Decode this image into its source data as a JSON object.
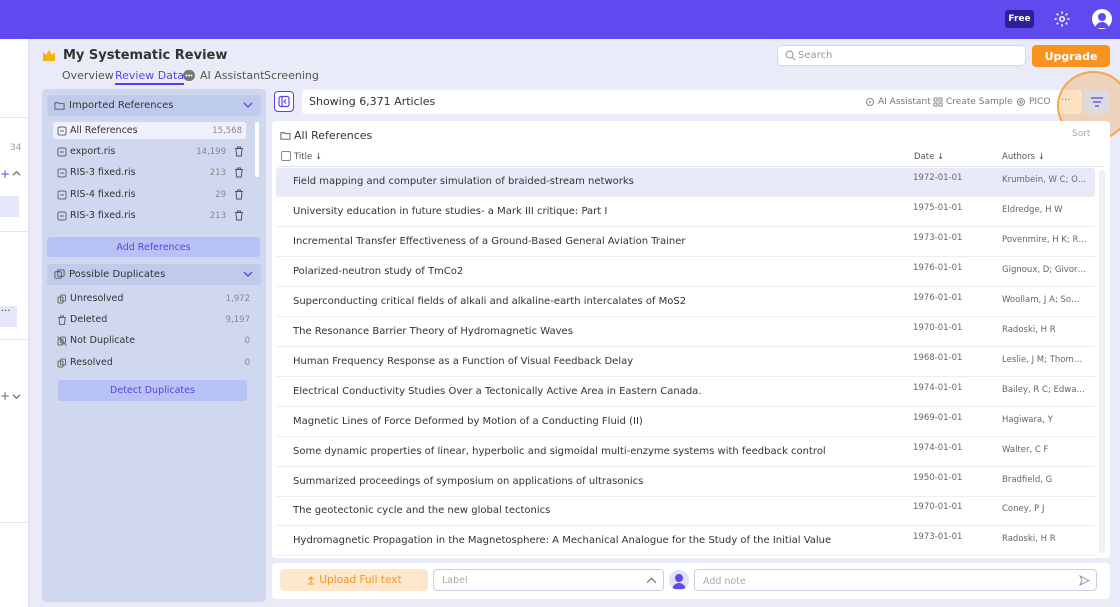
{
  "topbar": {
    "plan_badge": "Free",
    "brand_color": "#6149f0"
  },
  "left_strip": {
    "count": "34",
    "plus": "+",
    "more": "···"
  },
  "header": {
    "project_title": "My Systematic Review",
    "tabs": [
      {
        "label": "Overview"
      },
      {
        "label": "Review Data",
        "active": true
      },
      {
        "label": "AI Assistant"
      },
      {
        "label": "Screening"
      }
    ],
    "search_placeholder": "Search",
    "upgrade_label": "Upgrade",
    "upgrade_color": "#f7931e"
  },
  "sidebar": {
    "imported_title": "Imported References",
    "references": [
      {
        "name": "All References",
        "count": "15,568"
      },
      {
        "name": "export.ris",
        "count": "14,199"
      },
      {
        "name": "RIS-3 fixed.ris",
        "count": "213"
      },
      {
        "name": "RIS-4 fixed.ris",
        "count": "29"
      },
      {
        "name": "RIS-3 fixed.ris",
        "count": "213"
      }
    ],
    "add_references_label": "Add References",
    "duplicates_title": "Possible Duplicates",
    "duplicates": [
      {
        "name": "Unresolved",
        "count": "1,972"
      },
      {
        "name": "Deleted",
        "count": "9,197"
      },
      {
        "name": "Not Duplicate",
        "count": "0"
      },
      {
        "name": "Resolved",
        "count": "0"
      }
    ],
    "detect_label": "Detect Duplicates"
  },
  "toolbar": {
    "showing": "Showing 6,371 Articles",
    "ai_assistant": "AI Assistant",
    "create_sample": "Create Sample",
    "pico": "PICO",
    "more": "···"
  },
  "table": {
    "caption": "All References",
    "sort_label": "Sort",
    "col_title": "Title ↓",
    "col_date": "Date ↓",
    "col_authors": "Authors ↓",
    "rows": [
      {
        "title": "Field mapping and computer simulation of braided-stream networks",
        "date": "1972-01-01",
        "authors": "Krumbein, W C; O…"
      },
      {
        "title": "University education in future studies- a Mark III critique: Part I",
        "date": "1975-01-01",
        "authors": "Eldredge, H W"
      },
      {
        "title": "Incremental Transfer Effectiveness of a Ground-Based General Aviation Trainer",
        "date": "1973-01-01",
        "authors": "Povenmire, H K; R…"
      },
      {
        "title": "Polarized-neutron study of TmCo2",
        "date": "1976-01-01",
        "authors": "Gignoux, D; Givor…"
      },
      {
        "title": "Superconducting critical fields of alkali and alkaline-earth intercalates of MoS2",
        "date": "1976-01-01",
        "authors": "Woollam, J A; So…"
      },
      {
        "title": "The Resonance Barrier Theory of Hydromagnetic Waves",
        "date": "1970-01-01",
        "authors": "Radoski, H R"
      },
      {
        "title": "Human Frequency Response as a Function of Visual Feedback Delay",
        "date": "1968-01-01",
        "authors": "Leslie, J M; Thom…"
      },
      {
        "title": "Electrical Conductivity Studies Over a Tectonically Active Area in Eastern Canada.",
        "date": "1974-01-01",
        "authors": "Bailey, R C; Edwa…"
      },
      {
        "title": "Magnetic Lines of Force Deformed by Motion of a Conducting Fluid (II)",
        "date": "1969-01-01",
        "authors": "Hagiwara, Y"
      },
      {
        "title": "Some dynamic properties of linear, hyperbolic and sigmoidal multi-enzyme systems with feedback control",
        "date": "1974-01-01",
        "authors": "Walter, C F"
      },
      {
        "title": "Summarized proceedings of symposium on applications of ultrasonics",
        "date": "1950-01-01",
        "authors": "Bradfield, G"
      },
      {
        "title": "The geotectonic cycle and the new global tectonics",
        "date": "1970-01-01",
        "authors": "Coney, P J"
      },
      {
        "title": "Hydromagnetic Propagation in the Magnetosphere: A Mechanical Analogue for the Study of the Initial Value",
        "date": "1973-01-01",
        "authors": "Radoski, H R"
      }
    ]
  },
  "bottom": {
    "upload_label": "Upload Full text",
    "label_placeholder": "Label",
    "note_placeholder": "Add note"
  }
}
